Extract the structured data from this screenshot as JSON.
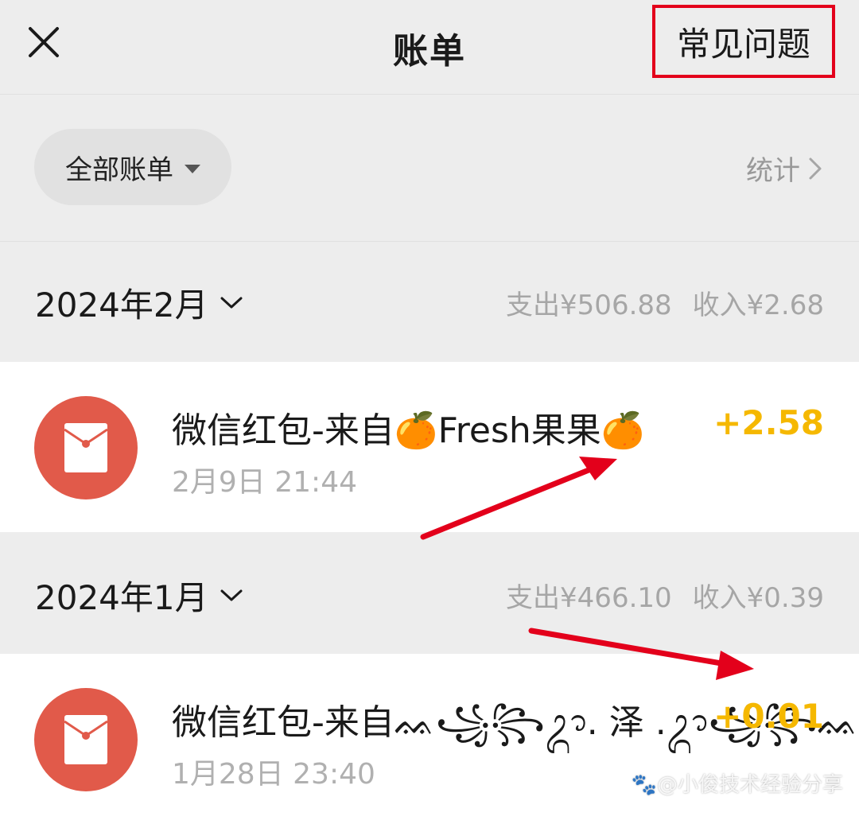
{
  "header": {
    "title": "账单",
    "faq_label": "常见问题"
  },
  "filter": {
    "selected": "全部账单",
    "stats_label": "统计"
  },
  "months": [
    {
      "label": "2024年2月",
      "expense": "支出¥506.88",
      "income": "收入¥2.68",
      "transactions": [
        {
          "name": "微信红包-来自🍊Fresh果果🍊",
          "time": "2月9日 21:44",
          "amount": "+2.58"
        }
      ]
    },
    {
      "label": "2024年1月",
      "expense": "支出¥466.10",
      "income": "收入¥0.39",
      "transactions": [
        {
          "name": "微信红包-来自ᨐ꧁꧂ᬊ. 泽 .ᬊ꧁꧂ᨐ",
          "time": "1月28日 23:40",
          "amount": "+0.01"
        }
      ]
    }
  ],
  "watermark": "🐾@小俊技术经验分享",
  "colors": {
    "background": "#ededed",
    "red_packet": "#e15a4a",
    "amount_income": "#f5b800",
    "annotation": "#e3001b"
  }
}
